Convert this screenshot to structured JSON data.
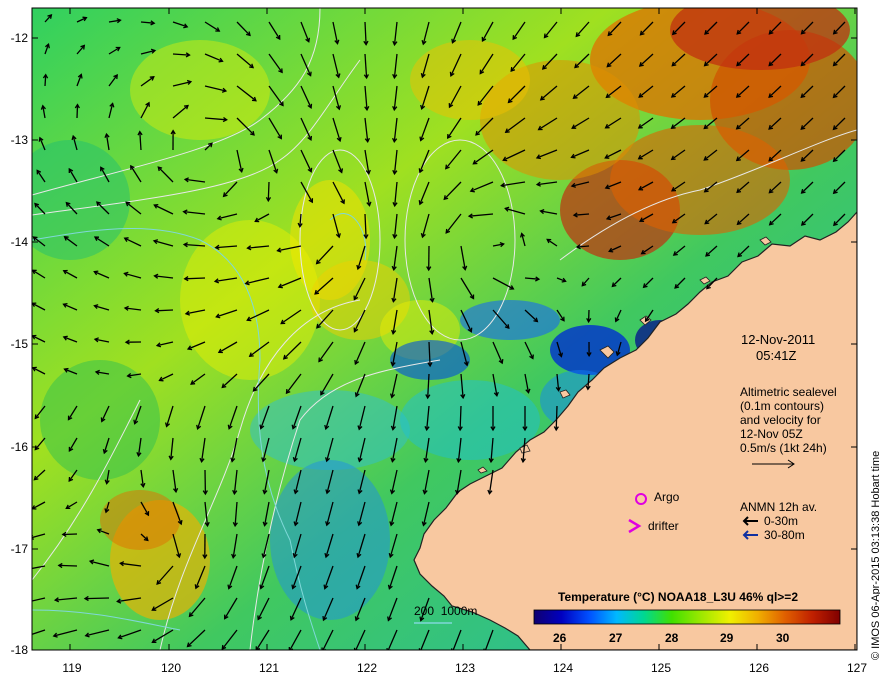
{
  "colors": {
    "land": "#f8c8a0",
    "coast": "#222222",
    "contour": "#e8e8e8",
    "isobath": "#7fd8d8",
    "argo": "#e000e0",
    "drifter": "#e000e0",
    "arrow_shallow": "#000000",
    "arrow_deep": "#1030a0"
  },
  "map": {
    "type": "sea-surface-temperature-map",
    "x_axis_ticks": [
      "119",
      "120",
      "121",
      "122",
      "123",
      "124",
      "125",
      "126",
      "127"
    ],
    "y_axis_ticks": [
      "-12",
      "-13",
      "-14",
      "-15",
      "-16",
      "-17",
      "-18"
    ],
    "lon_range": [
      118.6,
      127
    ],
    "lat_range": [
      -18,
      -11.7
    ]
  },
  "info": {
    "date": "12-Nov-2011",
    "time": "05:41Z",
    "altimetry_lines": [
      "Altimetric sealevel",
      "(0.1m contours)",
      "and velocity for",
      "12-Nov 05Z",
      "0.5m/s (1kt 24h)"
    ],
    "argo_label": "Argo",
    "drifter_label": "drifter",
    "drifter_symbol": ">",
    "anmn_title": "ANMN 12h av.",
    "anmn_shallow": "0-30m",
    "anmn_deep": "30-80m"
  },
  "isobath_label": "200  1000m",
  "colorbar": {
    "title": "Temperature (°C) NOAA18_L3U 46% ql>=2",
    "ticks": [
      "26",
      "27",
      "28",
      "29",
      "30"
    ],
    "range": [
      25.5,
      31
    ],
    "stops": [
      "#100070",
      "#0000c0",
      "#0050ff",
      "#00b8ff",
      "#00d890",
      "#40e000",
      "#a0e800",
      "#f0f000",
      "#f0b000",
      "#e06000",
      "#c02000",
      "#800000"
    ]
  },
  "credit": "© IMOS 06-Apr-2015 03:13:38 Hobart time"
}
